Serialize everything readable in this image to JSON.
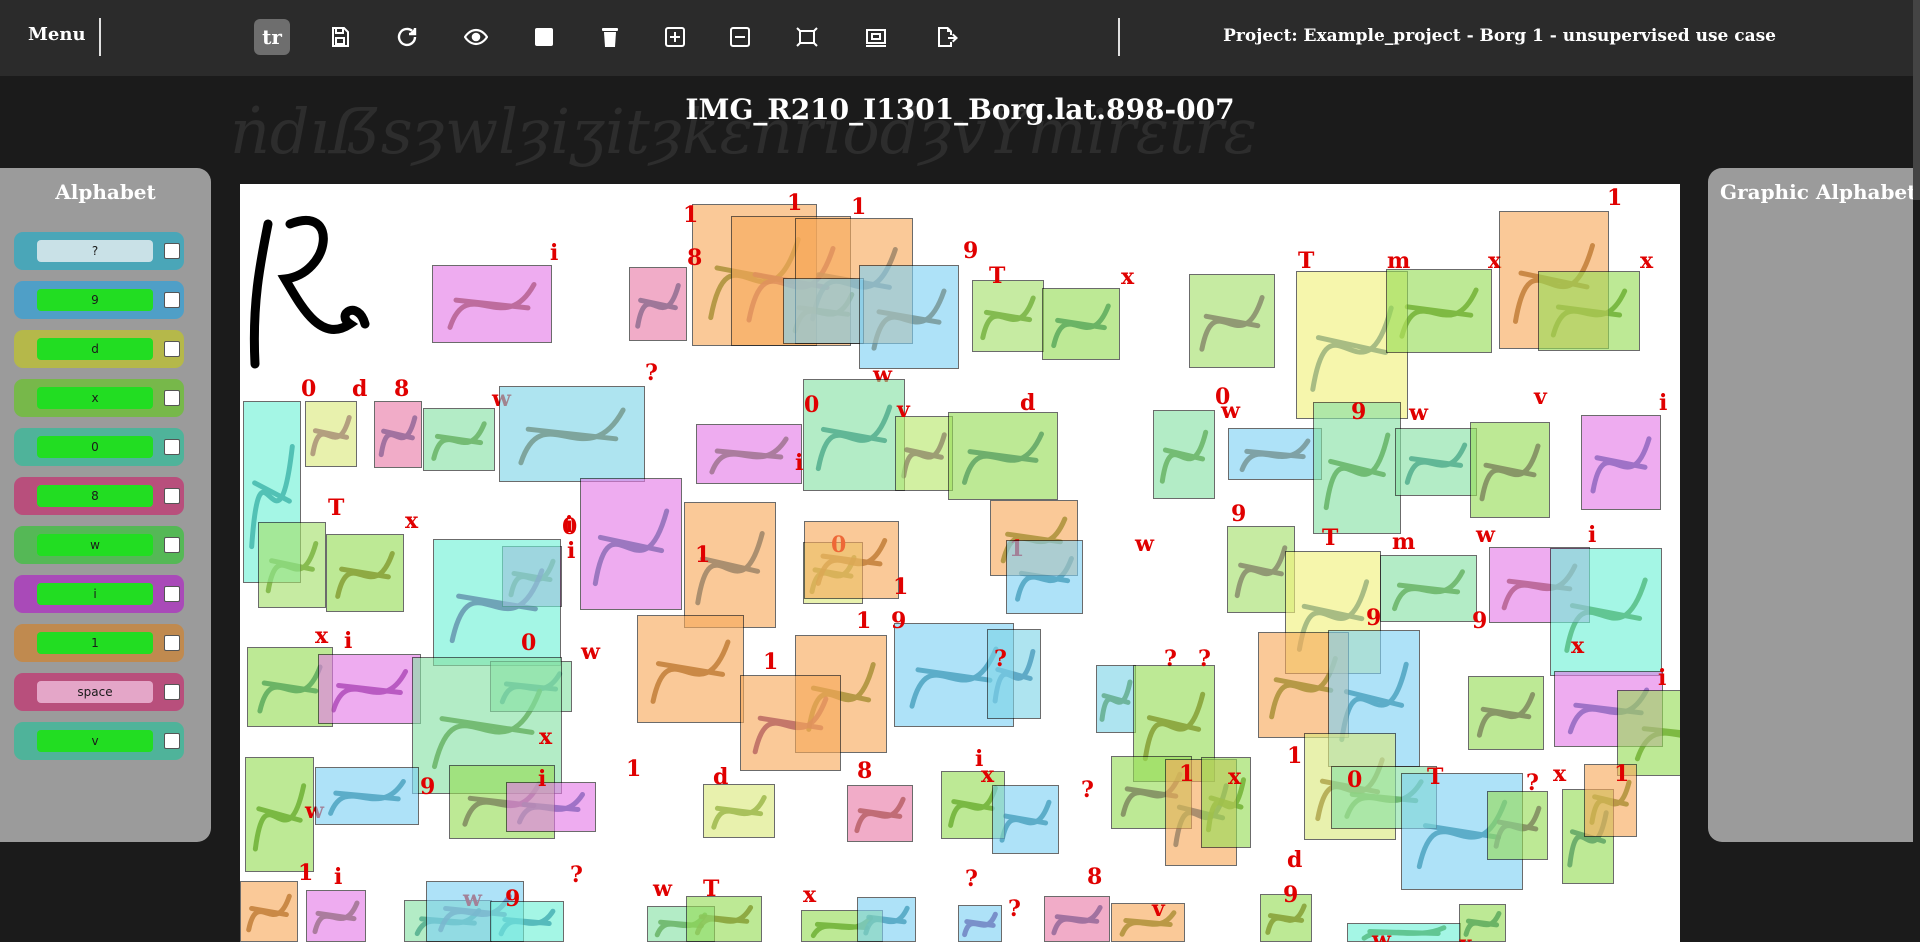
{
  "toolbar": {
    "menu_label": "Menu",
    "tools": [
      {
        "name": "transcribe-tool",
        "icon": "text-tool-icon",
        "label": "tr",
        "active": true
      },
      {
        "name": "save-tool",
        "icon": "save-icon"
      },
      {
        "name": "redo-tool",
        "icon": "redo-icon"
      },
      {
        "name": "visibility-tool",
        "icon": "eye-icon"
      },
      {
        "name": "square-tool",
        "icon": "square-icon"
      },
      {
        "name": "delete-tool",
        "icon": "trash-icon"
      },
      {
        "name": "add-box-tool",
        "icon": "plus-box-icon"
      },
      {
        "name": "remove-box-tool",
        "icon": "minus-box-icon"
      },
      {
        "name": "fit-tool",
        "icon": "fit-frame-icon"
      },
      {
        "name": "compare-tool",
        "icon": "compare-frame-icon"
      },
      {
        "name": "export-tool",
        "icon": "export-icon"
      }
    ],
    "project": "Project: Example_project - Borg 1 - unsupervised use case"
  },
  "document": {
    "title": "IMG_R210_I1301_Borg.lat.898-007"
  },
  "alphabet_panel": {
    "title": "Alphabet",
    "items": [
      {
        "label": "?",
        "color": "#4aa6b8",
        "pale": true
      },
      {
        "label": "9",
        "color": "#4f9fc7"
      },
      {
        "label": "d",
        "color": "#b5b84a"
      },
      {
        "label": "x",
        "color": "#77b84a"
      },
      {
        "label": "0",
        "color": "#4fb39a"
      },
      {
        "label": "8",
        "color": "#b84f7c"
      },
      {
        "label": "w",
        "color": "#55b856"
      },
      {
        "label": "i",
        "color": "#a94ab8"
      },
      {
        "label": "1",
        "color": "#c08a4f"
      },
      {
        "label": "space",
        "color": "#b84f7c"
      },
      {
        "label": "v",
        "color": "#4fb39a"
      }
    ]
  },
  "graphic_panel": {
    "title": "Graphic Alphabet"
  },
  "colors": {
    "i": "#e47ae8",
    "1": "#f7a95a",
    "8": "#e97aa8",
    "w": "#7ed1f5",
    "9": "#7ed1f5",
    "T": "#a4e06a",
    "x": "#96dd55",
    "m": "#f2f27a",
    "0": "#86e1a4",
    "d": "#dbe97c",
    "v": "#b8e86a",
    "?": "#7dd5e7",
    "tan": "#f7a95a",
    "cyan": "#6ef1d6"
  },
  "annotations": [
    {
      "label": "i",
      "color": "i"
    },
    {
      "label": "1",
      "color": "1"
    },
    {
      "label": "8",
      "color": "8"
    },
    {
      "label": "1",
      "color": "1"
    },
    {
      "label": "1",
      "color": "1"
    },
    {
      "label": "w",
      "color": "w"
    },
    {
      "label": "9",
      "color": "9"
    },
    {
      "label": "T",
      "color": "T"
    },
    {
      "label": "x",
      "color": "x"
    },
    {
      "label": "T",
      "color": "T"
    },
    {
      "label": "m",
      "color": "m"
    },
    {
      "label": "x",
      "color": "x"
    },
    {
      "label": "1",
      "color": "1"
    },
    {
      "label": "x",
      "color": "x"
    },
    {
      "label": "0",
      "color": "cyan"
    },
    {
      "label": "d",
      "color": "d"
    },
    {
      "label": "8",
      "color": "8"
    },
    {
      "label": "w",
      "color": "0"
    },
    {
      "label": "?",
      "color": "?"
    },
    {
      "label": "i",
      "color": "i"
    },
    {
      "label": "0",
      "color": "0"
    },
    {
      "label": "v",
      "color": "v"
    },
    {
      "label": "d",
      "color": "x"
    },
    {
      "label": "0",
      "color": "0"
    },
    {
      "label": "w",
      "color": "w"
    },
    {
      "label": "9",
      "color": "0"
    },
    {
      "label": "w",
      "color": "0"
    },
    {
      "label": "v",
      "color": "x"
    },
    {
      "label": "i",
      "color": "i"
    },
    {
      "label": "T",
      "color": "T"
    },
    {
      "label": "x",
      "color": "x"
    },
    {
      "label": "0",
      "color": "i"
    },
    {
      "label": "i",
      "color": "i"
    },
    {
      "label": "i",
      "color": "cyan"
    },
    {
      "label": "1",
      "color": "1"
    },
    {
      "label": "0",
      "color": "d"
    },
    {
      "label": "1",
      "color": "1"
    },
    {
      "label": "1",
      "color": "1"
    },
    {
      "label": "w",
      "color": "w"
    },
    {
      "label": "9",
      "color": "T"
    },
    {
      "label": "T",
      "color": "m"
    },
    {
      "label": "m",
      "color": "0"
    },
    {
      "label": "w",
      "color": "i"
    },
    {
      "label": "i",
      "color": "cyan"
    },
    {
      "label": "x",
      "color": "x"
    },
    {
      "label": "i",
      "color": "i"
    },
    {
      "label": "0",
      "color": "0"
    },
    {
      "label": "w",
      "color": "0"
    },
    {
      "label": "1",
      "color": "1"
    },
    {
      "label": "1",
      "color": "1"
    },
    {
      "label": "9",
      "color": "w"
    },
    {
      "label": "1",
      "color": "1"
    },
    {
      "label": "?",
      "color": "?"
    },
    {
      "label": "?",
      "color": "?"
    },
    {
      "label": "?",
      "color": "x"
    },
    {
      "label": "1",
      "color": "1"
    },
    {
      "label": "9",
      "color": "w"
    },
    {
      "label": "9",
      "color": "x"
    },
    {
      "label": "x",
      "color": "i"
    },
    {
      "label": "i",
      "color": "x"
    },
    {
      "label": "x",
      "color": "x"
    },
    {
      "label": "w",
      "color": "x"
    },
    {
      "label": "9",
      "color": "w"
    },
    {
      "label": "x",
      "color": "x"
    },
    {
      "label": "i",
      "color": "i"
    },
    {
      "label": "d",
      "color": "d"
    },
    {
      "label": "8",
      "color": "8"
    },
    {
      "label": "x",
      "color": "x"
    },
    {
      "label": "i",
      "color": "w"
    },
    {
      "label": "?",
      "color": "x"
    },
    {
      "label": "1",
      "color": "1"
    },
    {
      "label": "x",
      "color": "x"
    },
    {
      "label": "d",
      "color": "d"
    },
    {
      "label": "0",
      "color": "0"
    },
    {
      "label": "T",
      "color": "w"
    },
    {
      "label": "?",
      "color": "x"
    },
    {
      "label": "x",
      "color": "x"
    },
    {
      "label": "1",
      "color": "1"
    },
    {
      "label": "1",
      "color": "1"
    },
    {
      "label": "i",
      "color": "i"
    },
    {
      "label": "w",
      "color": "0"
    },
    {
      "label": "?",
      "color": "w"
    },
    {
      "label": "9",
      "color": "cyan"
    },
    {
      "label": "w",
      "color": "0"
    },
    {
      "label": "T",
      "color": "x"
    },
    {
      "label": "x",
      "color": "x"
    },
    {
      "label": "?",
      "color": "w"
    },
    {
      "label": "?",
      "color": "w"
    },
    {
      "label": "8",
      "color": "8"
    },
    {
      "label": "v",
      "color": "1"
    },
    {
      "label": "9",
      "color": "x"
    },
    {
      "label": "w",
      "color": "cyan"
    },
    {
      "label": "x",
      "color": "x"
    }
  ]
}
